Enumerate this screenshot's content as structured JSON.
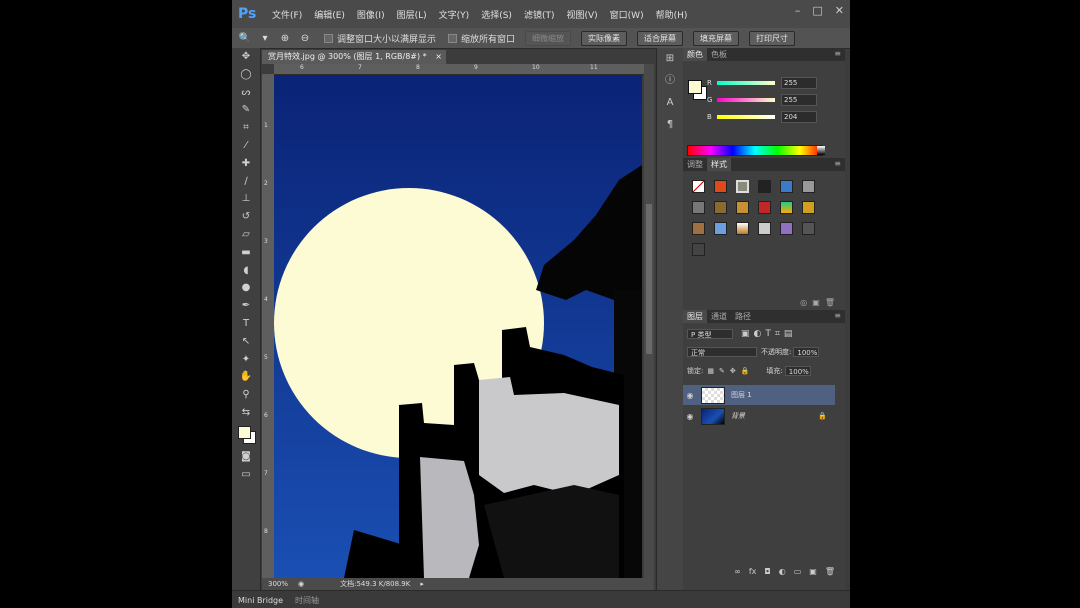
{
  "app": {
    "logo": "Ps"
  },
  "menu": [
    "文件(F)",
    "编辑(E)",
    "图像(I)",
    "图层(L)",
    "文字(Y)",
    "选择(S)",
    "滤镜(T)",
    "视图(V)",
    "窗口(W)",
    "帮助(H)"
  ],
  "window_controls": [
    "–",
    "□",
    "✕"
  ],
  "options": {
    "checkbox1": "调整窗口大小以满屏显示",
    "checkbox2": "缩放所有窗口",
    "button_scrubby": "细微缩放",
    "button_actual": "实际像素",
    "button_fit": "适合屏幕",
    "button_fill": "填充屏幕",
    "button_print": "打印尺寸"
  },
  "document": {
    "tab_title": "赏月特效.jpg @ 300% (图层 1, RGB/8#) *",
    "close_glyph": "×",
    "ruler_h": [
      "6",
      "7",
      "8",
      "9",
      "10",
      "11"
    ],
    "ruler_v": [
      "1",
      "2",
      "3",
      "4",
      "5",
      "6",
      "7",
      "8"
    ],
    "zoom": "300%",
    "doc_size": "文档:549.3 K/808.9K"
  },
  "bottom_tabs": {
    "mini_bridge": "Mini Bridge",
    "timeline": "时间轴"
  },
  "color_panel": {
    "tabs": [
      "颜色",
      "色板"
    ],
    "sliders": [
      {
        "label": "R",
        "value": "255"
      },
      {
        "label": "G",
        "value": "255"
      },
      {
        "label": "B",
        "value": "204"
      }
    ],
    "foreground": "#fdfbd3",
    "background": "#ffffff"
  },
  "styles_panel": {
    "tabs": [
      "调整",
      "样式"
    ]
  },
  "layers_panel": {
    "tabs": [
      "图层",
      "通道",
      "路径"
    ],
    "filter_kind": "P 类型",
    "blend_mode": "正常",
    "opacity_label": "不透明度:",
    "opacity": "100%",
    "lock_label": "锁定:",
    "fill_label": "填充:",
    "fill": "100%",
    "layers": [
      {
        "name": "图层 1",
        "selected": true
      },
      {
        "name": "背景",
        "selected": false
      }
    ]
  }
}
